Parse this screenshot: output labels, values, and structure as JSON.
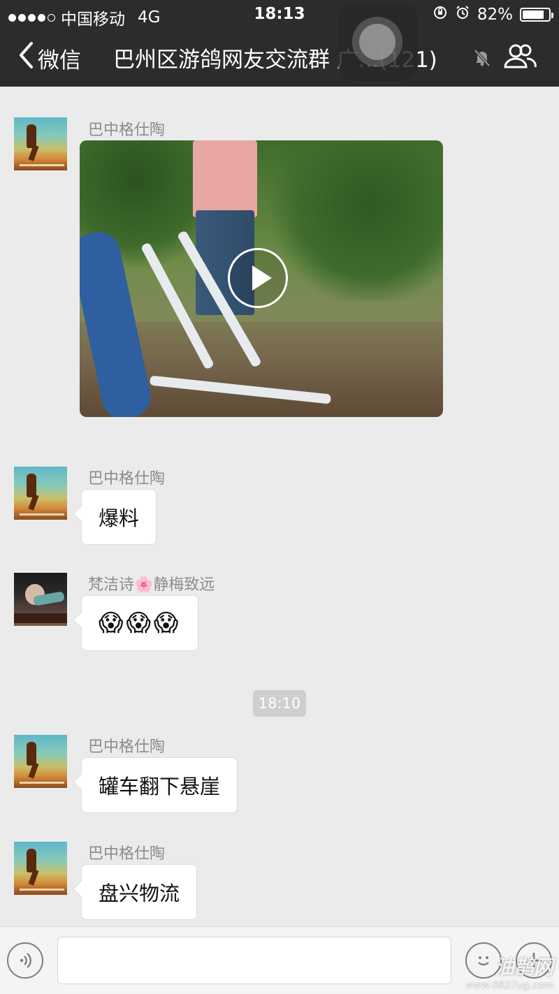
{
  "status_bar": {
    "carrier": "中国移动",
    "network": "4G",
    "time": "18:13",
    "battery_percent": "82%",
    "battery_level": 0.82
  },
  "nav": {
    "back_label": "微信",
    "title": "巴州区游鸽网友交流群 广...(121)",
    "mute_icon": "mute-bell-icon",
    "group_icon": "group-members-icon"
  },
  "messages": [
    {
      "sender": "巴中格仕陶",
      "type": "video",
      "avatar": "runner-avatar"
    },
    {
      "sender": "巴中格仕陶",
      "type": "text",
      "text": "爆料",
      "avatar": "runner-avatar"
    },
    {
      "sender": "梵洁诗🌸静梅致远",
      "type": "emoji",
      "text": "😱😱😱",
      "avatar": "woman-avatar"
    },
    {
      "sender": "巴中格仕陶",
      "type": "text",
      "text": "罐车翻下悬崖",
      "avatar": "runner-avatar"
    },
    {
      "sender": "巴中格仕陶",
      "type": "text",
      "text": "盘兴物流",
      "avatar": "runner-avatar"
    }
  ],
  "timestamp_divider": "18:10",
  "input_bar": {
    "voice_icon": "voice-icon",
    "emoji_icon": "emoji-icon",
    "plus_icon": "plus-icon",
    "text_value": ""
  },
  "watermark": {
    "big": "油鹊网",
    "small": "www.0827ug.com"
  },
  "colors": {
    "header_bg": "#2c2c2f",
    "chat_bg": "#ebebeb",
    "bubble_bg": "#ffffff",
    "sender_text": "#8c8c8c"
  }
}
